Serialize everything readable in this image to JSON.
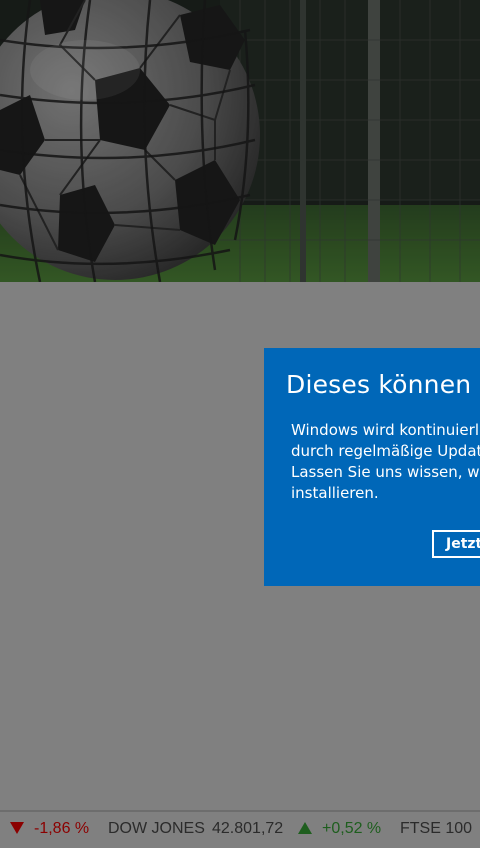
{
  "hero": {
    "image": "soccer-ball-in-net"
  },
  "toast": {
    "title": "Dieses können w",
    "body_lines": [
      "Windows wird kontinuierlic",
      "durch regelmäßige Update",
      "Lassen Sie uns wissen, wen",
      "installieren."
    ],
    "button_label": "Jetzt",
    "background_color": "#0067b8"
  },
  "ticker": {
    "items": [
      {
        "name": "",
        "value": "",
        "direction": "down",
        "change": "-1,86 %"
      },
      {
        "name": "DOW JONES",
        "value": "42.801,72",
        "direction": "up",
        "change": "+0,52 %"
      },
      {
        "name": "FTSE 100",
        "value": "",
        "direction": "",
        "change": ""
      }
    ],
    "negative_color": "#8b0000",
    "positive_color": "#1e5e1e"
  }
}
